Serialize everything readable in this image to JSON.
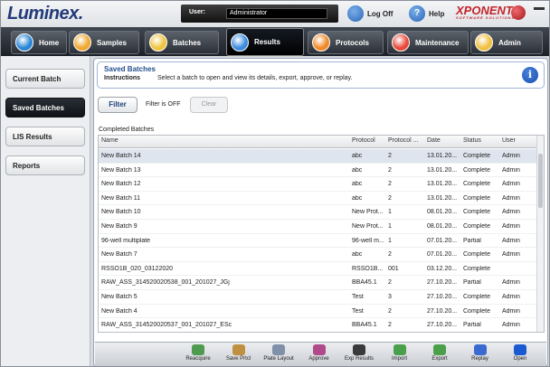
{
  "header": {
    "logo": "Luminex.",
    "user_label": "User:",
    "user_value": "Administrator",
    "logoff_label": "Log Off",
    "help_label": "Help",
    "brand": "XPONENT",
    "brand_sub": "SOFTWARE SOLUTIONS"
  },
  "nav": {
    "tabs": [
      {
        "label": "Home",
        "color": "#2a86d6"
      },
      {
        "label": "Samples",
        "color": "#f0a830"
      },
      {
        "label": "Batches",
        "color": "#f0c440"
      },
      {
        "label": "Results",
        "color": "#3c8be0"
      },
      {
        "label": "Protocols",
        "color": "#f08a2a"
      },
      {
        "label": "Maintenance",
        "color": "#e84a3a"
      },
      {
        "label": "Admin",
        "color": "#f0c040"
      }
    ]
  },
  "sidebar": {
    "items": [
      {
        "label": "Current Batch"
      },
      {
        "label": "Saved Batches"
      },
      {
        "label": "LIS Results"
      },
      {
        "label": "Reports"
      }
    ]
  },
  "info": {
    "title": "Saved Batches",
    "instructions_label": "Instructions",
    "instructions_text": "Select a batch to open and view its details, export, approve, or replay."
  },
  "filter": {
    "button_label": "Filter",
    "state_text": "Filter is OFF",
    "clear_label": "Clear"
  },
  "table": {
    "title": "Completed Batches",
    "columns": [
      "Name",
      "Protocol",
      "Protocol ...",
      "Date",
      "Status",
      "User"
    ],
    "rows": [
      [
        "New Batch 14",
        "abc",
        "2",
        "13.01.20...",
        "Complete",
        "Admin"
      ],
      [
        "New Batch 13",
        "abc",
        "2",
        "13.01.20...",
        "Complete",
        "Admin"
      ],
      [
        "New Batch 12",
        "abc",
        "2",
        "13.01.20...",
        "Complete",
        "Admin"
      ],
      [
        "New Batch 11",
        "abc",
        "2",
        "13.01.20...",
        "Complete",
        "Admin"
      ],
      [
        "New Batch 10",
        "New Prot...",
        "1",
        "08.01.20...",
        "Complete",
        "Admin"
      ],
      [
        "New Batch 9",
        "New Prot...",
        "1",
        "08.01.20...",
        "Complete",
        "Admin"
      ],
      [
        "96-well multiplate",
        "96-well m...",
        "1",
        "07.01.20...",
        "Partial",
        "Admin"
      ],
      [
        "New Batch 7",
        "abc",
        "2",
        "07.01.20...",
        "Complete",
        "Admin"
      ],
      [
        "RSSO1B_020_03122020",
        "RSSO1B...",
        "001",
        "03.12.20...",
        "Complete",
        ""
      ],
      [
        "RAW_ASS_314520020538_001_201027_JGj",
        "BBA45.1",
        "2",
        "27.10.20...",
        "Partial",
        "Admin"
      ],
      [
        "New Batch 5",
        "Test",
        "3",
        "27.10.20...",
        "Complete",
        "Admin"
      ],
      [
        "New Batch 4",
        "Test",
        "2",
        "27.10.20...",
        "Complete",
        "Admin"
      ],
      [
        "RAW_ASS_314520020537_001_201027_ESc",
        "BBA45.1",
        "2",
        "27.10.20...",
        "Partial",
        "Admin"
      ]
    ]
  },
  "toolbar": {
    "buttons": [
      {
        "label": "Reacquire",
        "icon": "reacquire-icon",
        "color": "#4e9a4e"
      },
      {
        "label": "Save Prtcl",
        "icon": "save-protocol-icon",
        "color": "#c09040"
      },
      {
        "label": "Plate Layout",
        "icon": "plate-layout-icon",
        "color": "#8090a8"
      },
      {
        "label": "Approve",
        "icon": "approve-icon",
        "color": "#b04a8a"
      },
      {
        "label": "Exp Results",
        "icon": "export-results-icon",
        "color": "#3a3a3a"
      },
      {
        "label": "Import",
        "icon": "import-icon",
        "color": "#4aa04a"
      },
      {
        "label": "Export",
        "icon": "export-icon",
        "color": "#4aa04a"
      },
      {
        "label": "Replay",
        "icon": "replay-icon",
        "color": "#3a6ad0"
      },
      {
        "label": "Open",
        "icon": "open-icon",
        "color": "#1a5ad0"
      }
    ]
  }
}
